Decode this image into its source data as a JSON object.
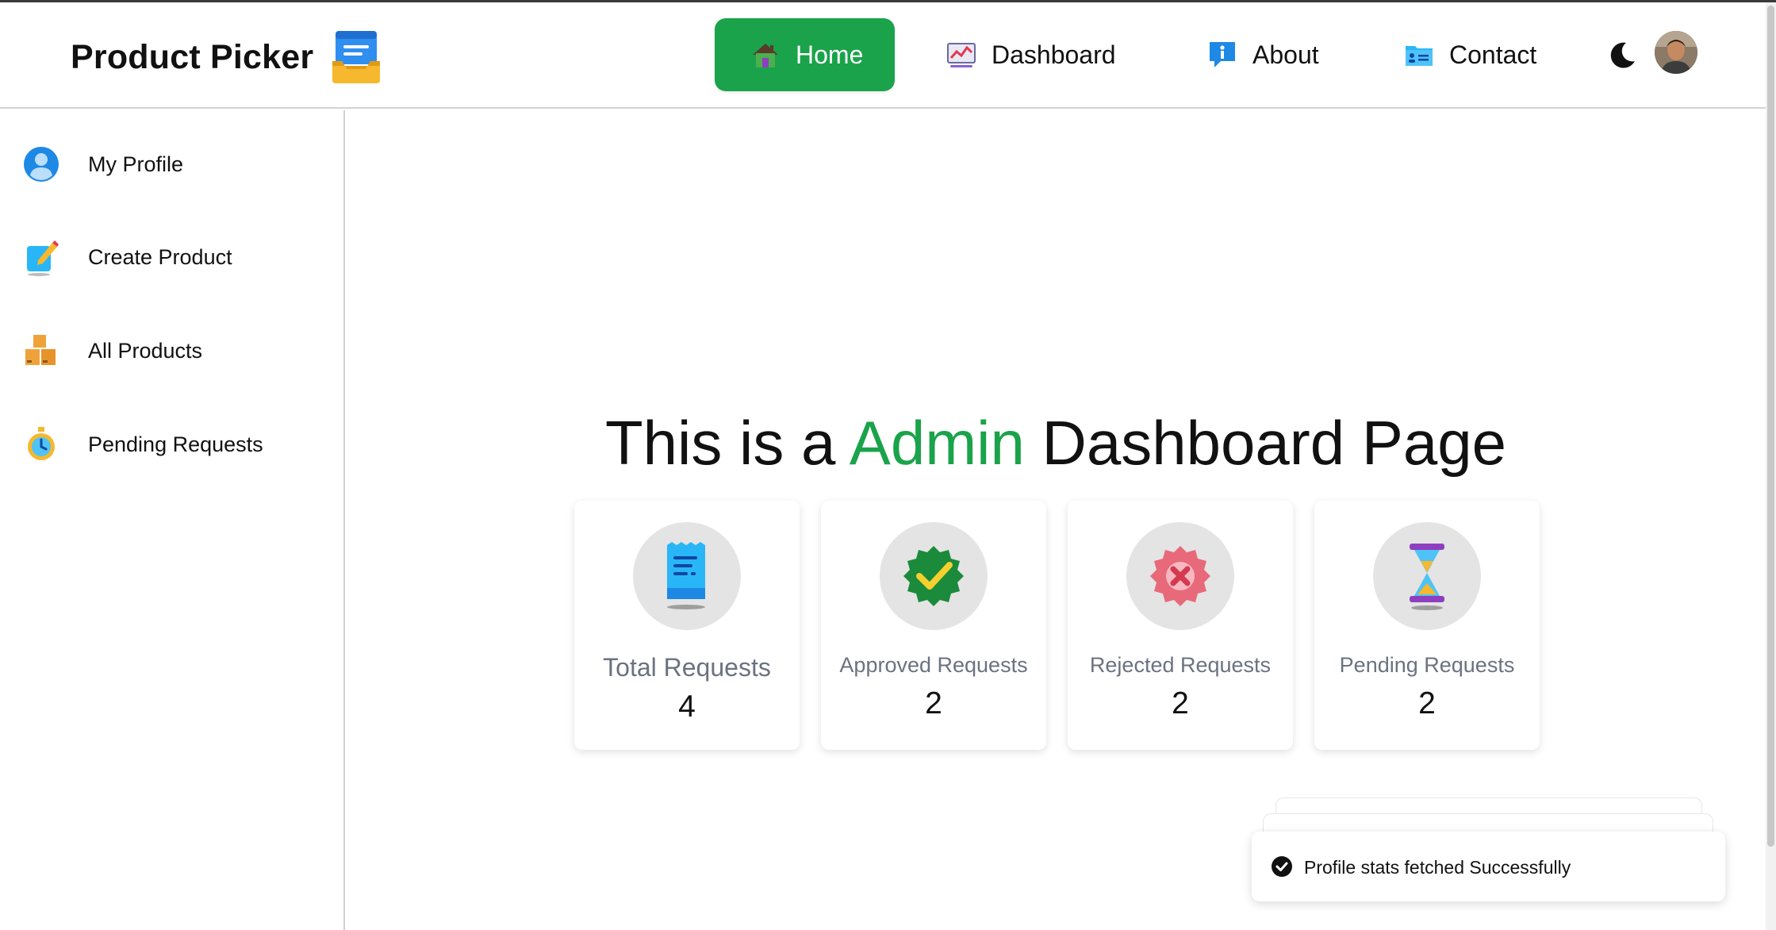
{
  "brand": {
    "name": "Product Picker",
    "icon": "inbox-tray-icon"
  },
  "nav": {
    "items": [
      {
        "label": "Home",
        "icon": "house-icon",
        "active": true
      },
      {
        "label": "Dashboard",
        "icon": "chart-icon",
        "active": false
      },
      {
        "label": "About",
        "icon": "info-icon",
        "active": false
      },
      {
        "label": "Contact",
        "icon": "contact-card-icon",
        "active": false
      }
    ],
    "theme_toggle_icon": "moon-icon",
    "avatar_icon": "user-avatar"
  },
  "sidebar": {
    "items": [
      {
        "label": "My Profile",
        "icon": "user-icon"
      },
      {
        "label": "Create Product",
        "icon": "edit-note-icon"
      },
      {
        "label": "All Products",
        "icon": "boxes-icon"
      },
      {
        "label": "Pending Requests",
        "icon": "stopwatch-icon"
      }
    ]
  },
  "main": {
    "title_prefix": "This is a ",
    "title_accent": "Admin",
    "title_suffix": " Dashboard Page",
    "stats": [
      {
        "label": "Total Requests",
        "value": "4",
        "icon": "receipt-icon"
      },
      {
        "label": "Approved Requests",
        "value": "2",
        "icon": "check-badge-icon"
      },
      {
        "label": "Rejected Requests",
        "value": "2",
        "icon": "x-badge-icon"
      },
      {
        "label": "Pending Requests",
        "value": "2",
        "icon": "hourglass-icon"
      }
    ]
  },
  "toast": {
    "message": "Profile stats fetched Successfully",
    "icon": "check-circle-icon"
  },
  "colors": {
    "accent": "#1aa34a",
    "text": "#111111",
    "muted": "#6b7280"
  }
}
